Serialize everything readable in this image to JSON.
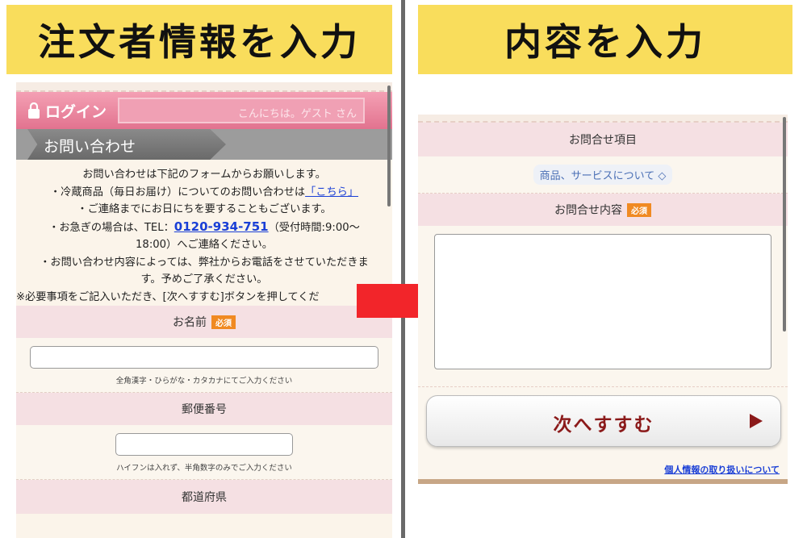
{
  "banners": {
    "left": "注文者情報を入力",
    "right": "内容を入力"
  },
  "left_phone": {
    "login_label": "ログイン",
    "greeting": "こんにちは。ゲスト さん",
    "breadcrumb": "お問い合わせ",
    "info": {
      "line1": "お問い合わせは下記のフォームからお願いします。",
      "line2_prefix": "・冷蔵商品（毎日お届け）についてのお問い合わせは",
      "line2_link": "「こちら」",
      "line3": "・ご連絡までにお日にちを要することもございます。",
      "line4_prefix": "・お急ぎの場合は、TEL：",
      "line4_tel": "0120-934-751",
      "line4_suffix": "（受付時間:9:00～",
      "line5": "18:00）へご連絡ください。",
      "line6": "・お問い合わせ内容によっては、弊社からお電話をさせていただきま",
      "line7": "す。予めご了承ください。",
      "line8": "※必要事項をご記入いただき、[次へすすむ]ボタンを押してくだ"
    },
    "name_section": {
      "label": "お名前",
      "required": "必須",
      "hint": "全角漢字・ひらがな・カタカナにてご入力ください"
    },
    "postal_section": {
      "label": "郵便番号",
      "hint": "ハイフンは入れず、半角数字のみでご入力ください"
    },
    "prefecture_section": {
      "label": "都道府県"
    }
  },
  "right_phone": {
    "category_label": "お問合せ項目",
    "category_selected": "商品、サービスについて ◇",
    "content_label": "お問合せ内容",
    "required": "必須",
    "next_button": "次へすすむ",
    "privacy_link": "個人情報の取り扱いについて"
  },
  "colors": {
    "banner": "#f9dd5c",
    "login_bar": "#e2738f",
    "section_header": "#f5e0e3",
    "required_badge": "#f08a22",
    "arrow": "#f2252a",
    "next_text": "#8b1a1a",
    "link": "#1a3fd6"
  }
}
